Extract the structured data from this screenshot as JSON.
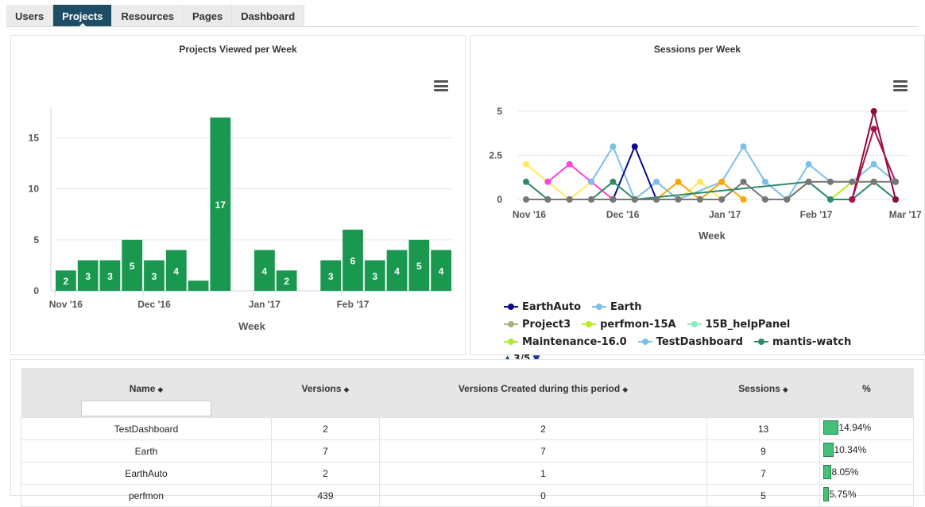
{
  "tabs": [
    "Users",
    "Projects",
    "Resources",
    "Pages",
    "Dashboard"
  ],
  "active_tab": "Projects",
  "chart_data": [
    {
      "type": "bar",
      "title": "Projects Viewed per Week",
      "xlabel": "Week",
      "ylabel": "",
      "ylim": [
        0,
        18
      ],
      "yticks": [
        0,
        5,
        10,
        15
      ],
      "xtick_labels": [
        "Nov '16",
        "Dec '16",
        "Jan '17",
        "Feb '17"
      ],
      "color": "#1a9850",
      "values": [
        2,
        3,
        3,
        5,
        3,
        4,
        1,
        17,
        0,
        4,
        2,
        0,
        3,
        6,
        3,
        4,
        5,
        4
      ],
      "data_labels": [
        "2",
        "3",
        "3",
        "5",
        "3",
        "4",
        "",
        "17",
        "",
        "4",
        "2",
        "",
        "3",
        "6",
        "3",
        "4",
        "5",
        "4"
      ]
    },
    {
      "type": "line",
      "title": "Sessions per Week",
      "xlabel": "Week",
      "ylabel": "",
      "ylim": [
        0,
        5
      ],
      "yticks": [
        "0",
        "2.5",
        "5"
      ],
      "xtick_labels": [
        "Nov '16",
        "Dec '16",
        "Jan '17",
        "Feb '17",
        "Mar '17"
      ],
      "series": [
        {
          "name": "EarthAuto",
          "color": "#0a0a8c",
          "values": [
            0,
            0,
            0,
            0,
            0,
            0,
            0,
            0,
            0,
            3,
            0,
            0,
            0,
            0,
            0,
            0,
            0,
            0,
            0,
            0,
            0,
            0,
            0,
            0,
            0,
            0,
            0,
            0,
            0
          ]
        },
        {
          "name": "Earth",
          "color": "#7cbfe8",
          "values": [
            0,
            0,
            0,
            0,
            0,
            0,
            0,
            0,
            3,
            0,
            1,
            0,
            0,
            0,
            0,
            0,
            0,
            0,
            0,
            0,
            0,
            0,
            0,
            0,
            0,
            0,
            0,
            0,
            0
          ]
        },
        {
          "name": "TestDashboard",
          "color": "#7cbfe8",
          "values": [
            0,
            0,
            0,
            0,
            0,
            0,
            0,
            0,
            0,
            0,
            0,
            0,
            0,
            0,
            0,
            0,
            0,
            0,
            0,
            0,
            0,
            0,
            0,
            0,
            0,
            0,
            0,
            0,
            0
          ]
        },
        {
          "name": "Project3",
          "color": "#aab080",
          "values": [
            0,
            0,
            0,
            0,
            0,
            0,
            0,
            0,
            0,
            0,
            0,
            0,
            0,
            0,
            0,
            0,
            0,
            0,
            0,
            0,
            0,
            0,
            0,
            0,
            0,
            0,
            0,
            0,
            0
          ]
        },
        {
          "name": "perfmon-15A",
          "color": "#b8ee1a",
          "values": [
            0,
            0,
            0,
            0,
            0,
            0,
            0,
            0,
            0,
            0,
            0,
            0,
            0,
            0,
            0,
            0,
            0,
            0,
            0,
            0,
            0,
            0,
            0,
            0,
            0,
            0,
            0,
            0,
            0
          ]
        },
        {
          "name": "15B_helpPanel",
          "color": "#88eec0",
          "values": [
            0,
            0,
            0,
            0,
            0,
            0,
            0,
            0,
            0,
            0,
            0,
            0,
            0,
            0,
            0,
            0,
            0,
            0,
            0,
            0,
            0,
            0,
            0,
            0,
            0,
            0,
            0,
            0,
            0
          ]
        },
        {
          "name": "Maintenance-16.0",
          "color": "#a8ee30",
          "values": [
            0,
            0,
            0,
            0,
            0,
            0,
            0,
            0,
            0,
            0,
            0,
            0,
            0,
            0,
            0,
            0,
            0,
            0,
            0,
            0,
            0,
            0,
            0,
            0,
            0,
            0,
            0,
            0,
            0
          ]
        },
        {
          "name": "mantis-watch",
          "color": "#2e8a6a",
          "values": [
            1,
            0,
            0,
            0,
            0,
            0,
            0,
            0,
            0,
            0,
            0,
            0,
            0,
            0,
            0,
            0,
            0,
            0,
            0,
            0,
            0,
            0,
            0,
            0,
            0,
            0,
            0,
            0,
            1
          ]
        }
      ],
      "legend_nav": "3/5"
    }
  ],
  "table": {
    "headers": [
      "Name",
      "Versions",
      "Versions Created during this period",
      "Sessions",
      "%"
    ],
    "rows": [
      {
        "name": "TestDashboard",
        "versions": "2",
        "created": "2",
        "sessions": "13",
        "pct": "14.94%",
        "pct_value": 14.94
      },
      {
        "name": "Earth",
        "versions": "7",
        "created": "7",
        "sessions": "9",
        "pct": "10.34%",
        "pct_value": 10.34
      },
      {
        "name": "EarthAuto",
        "versions": "2",
        "created": "1",
        "sessions": "7",
        "pct": "8.05%",
        "pct_value": 8.05
      },
      {
        "name": "perfmon",
        "versions": "439",
        "created": "0",
        "sessions": "5",
        "pct": "5.75%",
        "pct_value": 5.75
      }
    ]
  }
}
